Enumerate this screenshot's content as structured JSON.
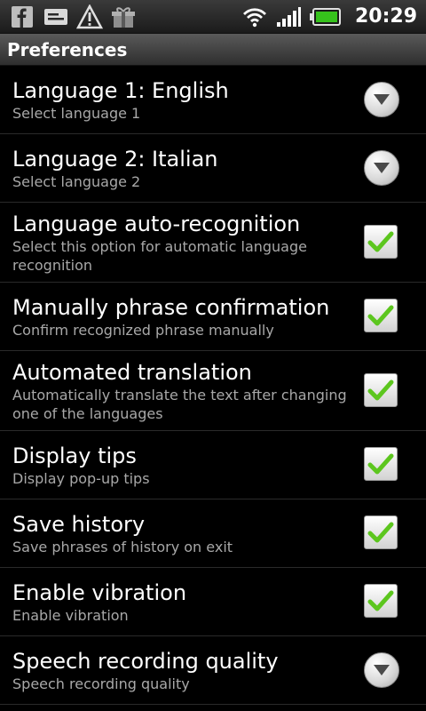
{
  "status_bar": {
    "time": "20:29",
    "left_icons": [
      "facebook-icon",
      "message-icon",
      "warning-icon",
      "gift-icon"
    ],
    "right_icons": [
      "wifi-icon",
      "signal-icon",
      "battery-icon"
    ]
  },
  "title": "Preferences",
  "preferences": [
    {
      "title": "Language 1: English",
      "summary": "Select language 1",
      "widget": "dropdown"
    },
    {
      "title": "Language 2: Italian",
      "summary": "Select language 2",
      "widget": "dropdown"
    },
    {
      "title": "Language auto-recognition",
      "summary": "Select this option for automatic language recognition",
      "widget": "checkbox",
      "checked": true
    },
    {
      "title": "Manually phrase confirmation",
      "summary": "Confirm recognized phrase manually",
      "widget": "checkbox",
      "checked": true
    },
    {
      "title": "Automated translation",
      "summary": "Automatically translate the text after changing one of the languages",
      "widget": "checkbox",
      "checked": true
    },
    {
      "title": "Display tips",
      "summary": "Display pop-up tips",
      "widget": "checkbox",
      "checked": true
    },
    {
      "title": "Save history",
      "summary": "Save phrases of history on exit",
      "widget": "checkbox",
      "checked": true
    },
    {
      "title": "Enable vibration",
      "summary": "Enable vibration",
      "widget": "checkbox",
      "checked": true
    },
    {
      "title": "Speech recording quality",
      "summary": "Speech recording quality",
      "widget": "dropdown"
    }
  ],
  "colors": {
    "background": "#000000",
    "summary_text": "#a8a8a8",
    "check_green": "#5cc61e"
  }
}
